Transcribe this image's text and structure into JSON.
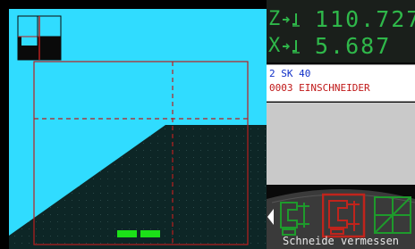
{
  "coordinates": {
    "z": {
      "axis": "Z",
      "value": "110.727"
    },
    "x": {
      "axis": "X",
      "value": "5.687"
    }
  },
  "tool": {
    "line1": "2  SK 40",
    "line2": "0003 EINSCHNEIDER"
  },
  "softkeys": {
    "active_label": "Schneide vermessen",
    "items": [
      {
        "icon": "tool-measure-icon"
      },
      {
        "icon": "cutting-edge-measure-icon"
      },
      {
        "icon": "grid-tool-icon"
      }
    ]
  },
  "colors": {
    "viewport_background": "#30dcff",
    "workpiece": "#0d2626",
    "frame_lines": "#b81e1e",
    "coordinate_text": "#2fb84a",
    "softkey_highlight": "#c0241c",
    "marker": "#1ce018"
  }
}
